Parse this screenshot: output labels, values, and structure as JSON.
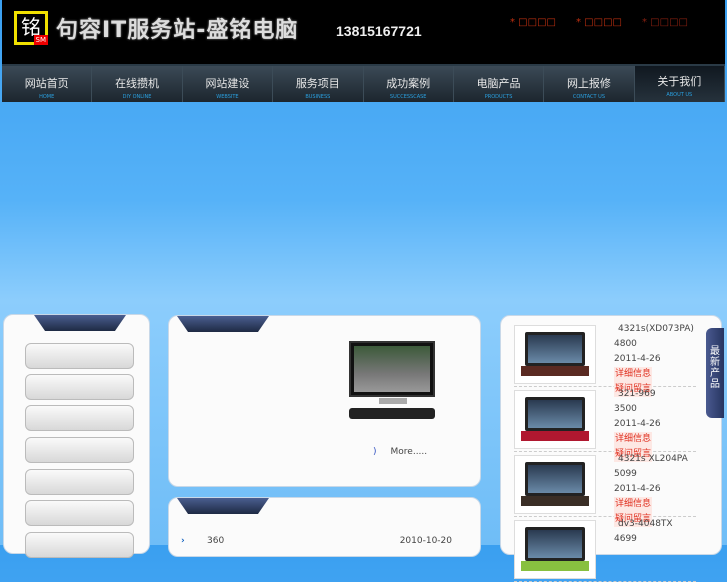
{
  "header": {
    "logo_char": "铭",
    "logo_badge": "SM",
    "site_name": "句容IT服务站-盛铭电脑",
    "phone": "13815167721",
    "top_links": [
      "* □□□□",
      "* □□□□",
      "* □□□□"
    ]
  },
  "nav": [
    {
      "cn": "网站首页",
      "en": "HOME"
    },
    {
      "cn": "在线攒机",
      "en": "DIY ONLINE"
    },
    {
      "cn": "网站建设",
      "en": "WEBSITE"
    },
    {
      "cn": "服务项目",
      "en": "BUSINESS"
    },
    {
      "cn": "成功案例",
      "en": "SUCCESSCASE"
    },
    {
      "cn": "电脑产品",
      "en": "PRODUCTS"
    },
    {
      "cn": "网上报修",
      "en": "CONTACT US"
    },
    {
      "cn": "关于我们",
      "en": "ABOUT US"
    }
  ],
  "featured": {
    "more_arrow": ")",
    "more": "More....."
  },
  "news": [
    {
      "title": "360",
      "date": "2010-10-20"
    }
  ],
  "products": {
    "side_tab": "最新产品",
    "detail_label": "详细信息",
    "question_label": "疑问留言",
    "items": [
      {
        "name": "4321s(XD073PA)",
        "price": "4800",
        "date": "2011-4-26",
        "color": "#5a2a22"
      },
      {
        "name": "321-969",
        "price": "3500",
        "date": "2011-4-26",
        "color": "#b01830"
      },
      {
        "name": "4321s XL204PA",
        "price": "5099",
        "date": "2011-4-26",
        "color": "#3a2e26"
      },
      {
        "name": "dv3-4048TX",
        "price": "4699",
        "date": "",
        "color": "#88c040"
      }
    ]
  }
}
